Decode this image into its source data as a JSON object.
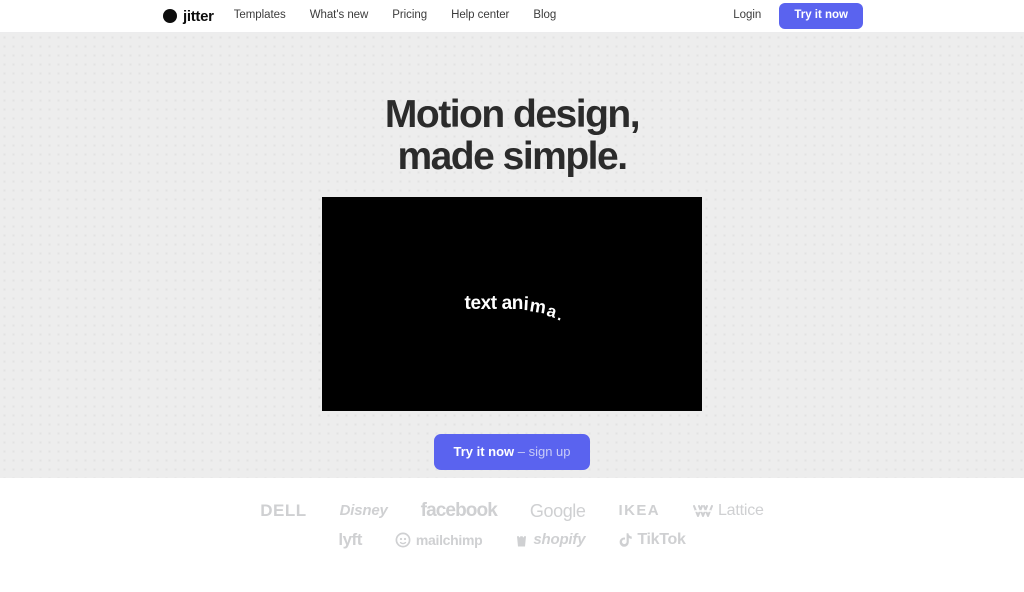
{
  "header": {
    "brand": {
      "mark": "circle-logo-mark",
      "name": "jitter"
    },
    "nav": [
      {
        "label": "Templates",
        "name": "nav-link-templates"
      },
      {
        "label": "What's new",
        "name": "nav-link-whats-new"
      },
      {
        "label": "Pricing",
        "name": "nav-link-pricing"
      },
      {
        "label": "Help center",
        "name": "nav-link-help-center"
      },
      {
        "label": "Blog",
        "name": "nav-link-blog"
      }
    ],
    "login_label": "Login",
    "cta_label": "Try it now"
  },
  "hero": {
    "title_line1": "Motion design,",
    "title_line2": "made simple.",
    "video": {
      "caption_chars": [
        "t",
        "e",
        "x",
        "t",
        " ",
        "a",
        "n",
        "i",
        "m",
        "a",
        "."
      ],
      "caption_text": "text anima.",
      "background_color": "#000000"
    },
    "cta": {
      "strong_label": "Try it now",
      "sub_label": " – sign up"
    },
    "background_color": "#ededed",
    "dot_color": "#e2e2e2"
  },
  "logos": {
    "row1": [
      {
        "label": "DELL",
        "name": "logo-dell"
      },
      {
        "label": "Disney",
        "name": "logo-disney"
      },
      {
        "label": "facebook",
        "name": "logo-facebook"
      },
      {
        "label": "Google",
        "name": "logo-google"
      },
      {
        "label": "IKEA",
        "name": "logo-ikea"
      },
      {
        "label": "Lattice",
        "name": "logo-lattice"
      }
    ],
    "row2": [
      {
        "label": "lyft",
        "name": "logo-lyft"
      },
      {
        "label": "mailchimp",
        "name": "logo-mailchimp"
      },
      {
        "label": "shopify",
        "name": "logo-shopify"
      },
      {
        "label": "TikTok",
        "name": "logo-tiktok"
      }
    ],
    "color": "#cfd0d2"
  },
  "colors": {
    "accent": "#5a63ef",
    "text_dark": "#2b2b2b",
    "hero_bg": "#ededed",
    "page_bg": "#ffffff"
  }
}
